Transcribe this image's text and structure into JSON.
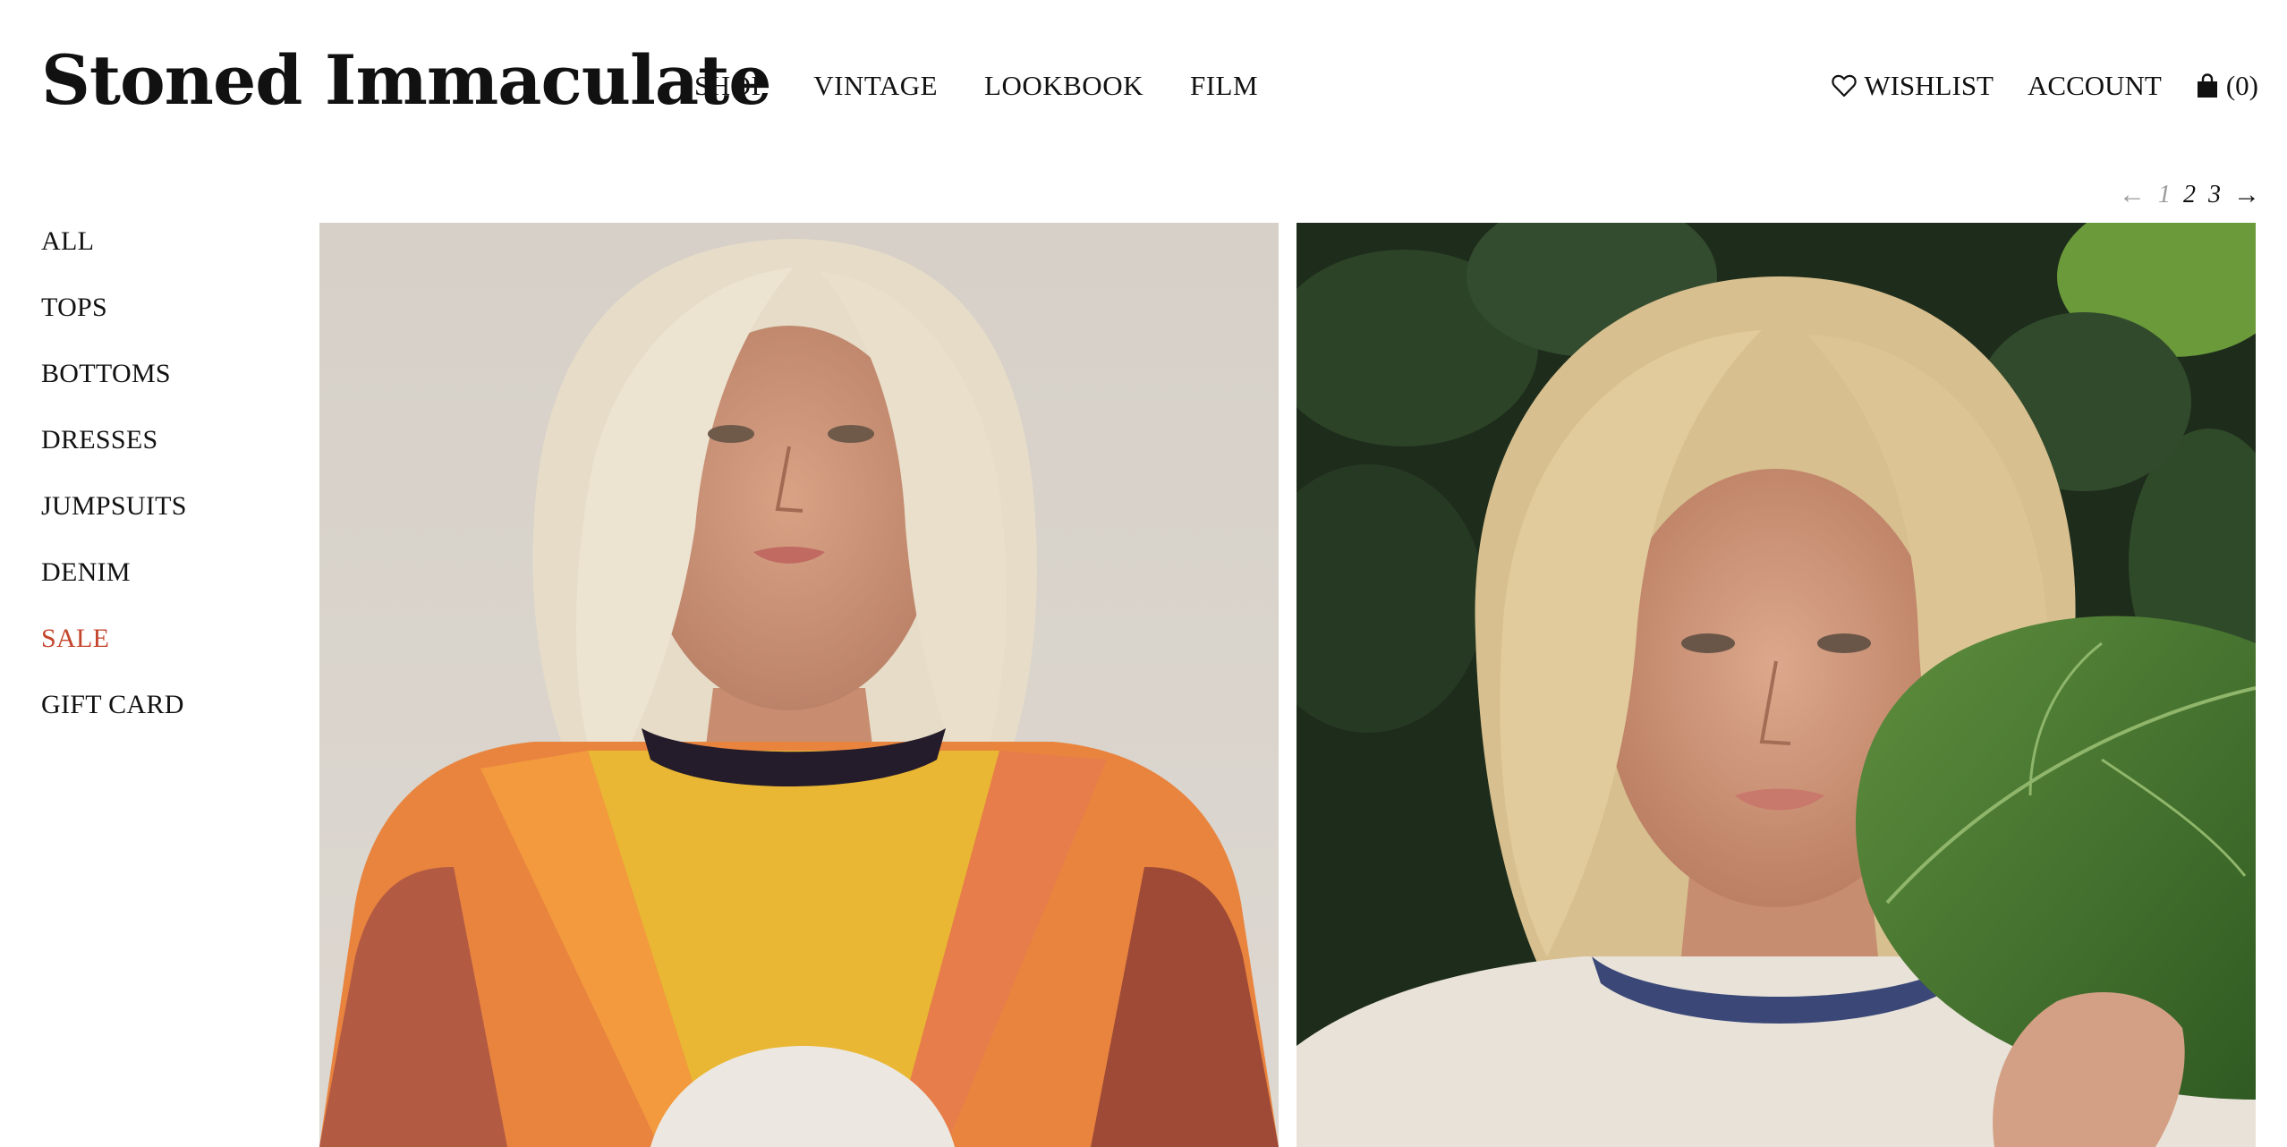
{
  "brand": {
    "logo_text": "Stoned Immaculate"
  },
  "main_nav": [
    {
      "label": "SHOP"
    },
    {
      "label": "VINTAGE"
    },
    {
      "label": "LOOKBOOK"
    },
    {
      "label": "FILM"
    }
  ],
  "utility_nav": {
    "wishlist_label": "WISHLIST",
    "wishlist_icon": "heart-icon",
    "account_label": "ACCOUNT",
    "cart_icon": "shopping-bag-icon",
    "cart_count": "(0)"
  },
  "pagination": {
    "prev": "←",
    "pages": [
      "1",
      "2",
      "3"
    ],
    "current": "1",
    "next": "→"
  },
  "sidebar": {
    "items": [
      {
        "label": "ALL"
      },
      {
        "label": "TOPS"
      },
      {
        "label": "BOTTOMS"
      },
      {
        "label": "DRESSES"
      },
      {
        "label": "JUMPSUITS"
      },
      {
        "label": "DENIM"
      },
      {
        "label": "SALE"
      },
      {
        "label": "GIFT CARD"
      }
    ],
    "sale_color": "#c4452d"
  },
  "products": [
    {
      "image": "model-orange-sunset-sweater-photo",
      "background": "#d8d3cc"
    },
    {
      "image": "model-white-ringer-tee-fig-leaves-photo",
      "background": "#22321f"
    }
  ]
}
